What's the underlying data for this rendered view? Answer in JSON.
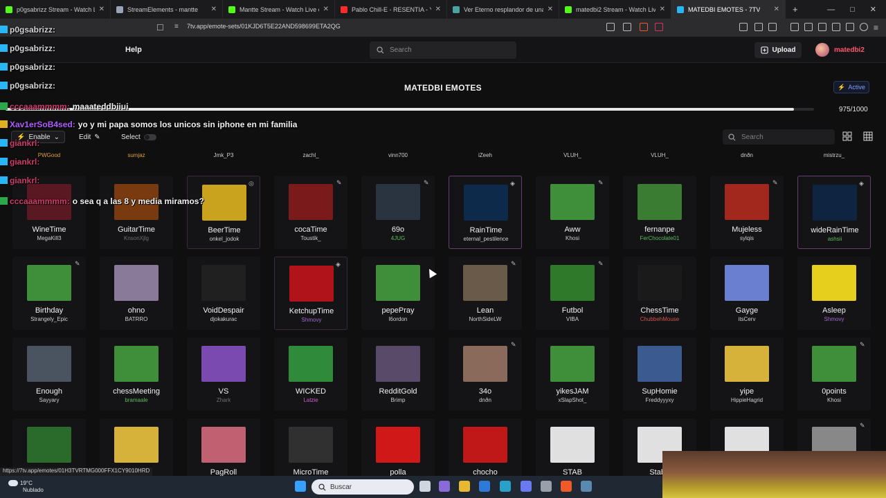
{
  "browser": {
    "tabs": [
      {
        "label": "p0gsabrizz Stream - Watch Live on Kick",
        "icon": "kick-icon",
        "color": "#53fc18"
      },
      {
        "label": "StreamElements - mantte",
        "icon": "streamelements-icon",
        "color": "#9aa4b5"
      },
      {
        "label": "Mantte Stream - Watch Live on Kick",
        "icon": "kick-icon",
        "color": "#53fc18"
      },
      {
        "label": "Pablo Chill-E - RESENTIA - YouTube",
        "icon": "youtube-icon",
        "color": "#ff2b2b"
      },
      {
        "label": "Ver Eterno resplandor de una mente",
        "icon": "stream-icon",
        "color": "#4aa3a0"
      },
      {
        "label": "matedbi2 Stream - Watch Live on Kick",
        "icon": "kick-icon",
        "color": "#53fc18"
      },
      {
        "label": "MATEDBI EMOTES - 7TV",
        "icon": "7tv-icon",
        "color": "#29b6f6",
        "active": true
      }
    ],
    "url": "7tv.app/emote-sets/01KJD6T5E22AND598699ETA2QG",
    "status_url": "https://7tv.app/emotes/01H3TVRTMG000FFX1CY9010HRD"
  },
  "site": {
    "nav_help": "Help",
    "search_placeholder": "Search",
    "upload_label": "Upload",
    "username": "matedbi2",
    "user_color": "#ff5570"
  },
  "emote_set": {
    "title": "MATEDBI EMOTES",
    "active_label": "Active",
    "capacity": {
      "used": 975,
      "total": 1000,
      "label": "975/1000"
    },
    "enable_label": "Enable",
    "edit_label": "Edit",
    "select_label": "Select",
    "search_placeholder": "Search"
  },
  "prev_row_owners": [
    {
      "name": "PWGood",
      "color": "#e0a030"
    },
    {
      "name": "sumjaz",
      "color": "#e0a030"
    },
    {
      "name": "Jmk_P3",
      "color": "#cfcfcf"
    },
    {
      "name": "zachl_",
      "color": "#cfcfcf"
    },
    {
      "name": "vinn700",
      "color": "#cfcfcf"
    },
    {
      "name": "iZeeh",
      "color": "#cfcfcf"
    },
    {
      "name": "VLUH_",
      "color": "#cfcfcf"
    },
    {
      "name": "VLUH_",
      "color": "#cfcfcf"
    },
    {
      "name": "dnðn",
      "color": "#cfcfcf"
    },
    {
      "name": "mistrzu_",
      "color": "#cfcfcf"
    }
  ],
  "emotes": [
    {
      "name": "WineTime",
      "owner": "MegaKill3",
      "owner_color": "#cfcfcf",
      "thumb": "#5a1822",
      "outline": false,
      "badge": ""
    },
    {
      "name": "GuitarTime",
      "owner": "KnsonXjlg",
      "owner_color": "#6e6e72",
      "thumb": "#7a3a10",
      "outline": false,
      "badge": ""
    },
    {
      "name": "BeerTime",
      "owner": "onkel_jodok",
      "owner_color": "#cfcfcf",
      "thumb": "#c9a21e",
      "outline": "outline",
      "badge": "◎"
    },
    {
      "name": "cocaTime",
      "owner": "Toustik_",
      "owner_color": "#cfcfcf",
      "thumb": "#7a1a1a",
      "outline": false,
      "badge": "✎"
    },
    {
      "name": "69o",
      "owner": "4JUG",
      "owner_color": "#5dbb5d",
      "thumb": "#2a3440",
      "outline": false,
      "badge": "✎"
    },
    {
      "name": "RainTime",
      "owner": "eternal_pestilence",
      "owner_color": "#cfcfcf",
      "thumb": "#0d2a4a",
      "outline": "outline2",
      "badge": "◈"
    },
    {
      "name": "Aww",
      "owner": "Khosi",
      "owner_color": "#cfcfcf",
      "thumb": "#3f8f3a",
      "outline": false,
      "badge": "✎"
    },
    {
      "name": "fernanpe",
      "owner": "FerChocolate01",
      "owner_color": "#5dbb5d",
      "thumb": "#3a7d32",
      "outline": false,
      "badge": ""
    },
    {
      "name": "Mujeless",
      "owner": "sylqis",
      "owner_color": "#cfcfcf",
      "thumb": "#a2281e",
      "outline": false,
      "badge": "✎"
    },
    {
      "name": "wideRainTime",
      "owner": "ashsii",
      "owner_color": "#5dbb5d",
      "thumb": "#0f2440",
      "outline": "outline2",
      "badge": "◈"
    },
    {
      "name": "Birthday",
      "owner": "Strangely_Epic",
      "owner_color": "#cfcfcf",
      "thumb": "#3f8f3a",
      "outline": false,
      "badge": "✎"
    },
    {
      "name": "ohno",
      "owner": "BATRRO",
      "owner_color": "#cfcfcf",
      "thumb": "#8a7a9a",
      "outline": false,
      "badge": ""
    },
    {
      "name": "VoidDespair",
      "owner": "djokakurac",
      "owner_color": "#cfcfcf",
      "thumb": "#202020",
      "outline": false,
      "badge": ""
    },
    {
      "name": "KetchupTime",
      "owner": "Shmovy",
      "owner_color": "#a06ad6",
      "thumb": "#b0141a",
      "outline": "outline",
      "badge": "◈"
    },
    {
      "name": "pepePray",
      "owner": "l6ordon",
      "owner_color": "#cfcfcf",
      "thumb": "#3f8f3a",
      "outline": false,
      "badge": ""
    },
    {
      "name": "Lean",
      "owner": "NorthSideLW",
      "owner_color": "#cfcfcf",
      "thumb": "#6a5a4a",
      "outline": false,
      "badge": "✎"
    },
    {
      "name": "Futbol",
      "owner": "VIBA",
      "owner_color": "#cfcfcf",
      "thumb": "#2f7a2a",
      "outline": false,
      "badge": "✎"
    },
    {
      "name": "ChessTime",
      "owner": "ChubbehMouse",
      "owner_color": "#d2554a",
      "thumb": "#1a1a1a",
      "outline": false,
      "badge": ""
    },
    {
      "name": "Gayge",
      "owner": "itsCerv",
      "owner_color": "#cfcfcf",
      "thumb": "#6a7fd0",
      "outline": false,
      "badge": ""
    },
    {
      "name": "Asleep",
      "owner": "Shmovy",
      "owner_color": "#a06ad6",
      "thumb": "#e7cf1e",
      "outline": false,
      "badge": ""
    },
    {
      "name": "Enough",
      "owner": "Sayyary",
      "owner_color": "#cfcfcf",
      "thumb": "#4a5460",
      "outline": false,
      "badge": ""
    },
    {
      "name": "chessMeeting",
      "owner": "bramaale",
      "owner_color": "#5dbb5d",
      "thumb": "#3f8f3a",
      "outline": false,
      "badge": ""
    },
    {
      "name": "VS",
      "owner": "Zhark",
      "owner_color": "#6e6e72",
      "thumb": "#7a4ab0",
      "outline": false,
      "badge": ""
    },
    {
      "name": "WICKED",
      "owner": "Latzie",
      "owner_color": "#d05bd0",
      "thumb": "#2f8a3a",
      "outline": false,
      "badge": ""
    },
    {
      "name": "RedditGold",
      "owner": "Brimp",
      "owner_color": "#cfcfcf",
      "thumb": "#5a4a6a",
      "outline": false,
      "badge": ""
    },
    {
      "name": "34o",
      "owner": "dnðn",
      "owner_color": "#cfcfcf",
      "thumb": "#8a6a5a",
      "outline": false,
      "badge": "✎"
    },
    {
      "name": "yikesJAM",
      "owner": "xSlapShot_",
      "owner_color": "#cfcfcf",
      "thumb": "#3f8f3a",
      "outline": false,
      "badge": ""
    },
    {
      "name": "SupHomie",
      "owner": "Freddyyyxy",
      "owner_color": "#cfcfcf",
      "thumb": "#3a5a90",
      "outline": false,
      "badge": ""
    },
    {
      "name": "yipe",
      "owner": "HippieHagrid",
      "owner_color": "#cfcfcf",
      "thumb": "#d6b23a",
      "outline": false,
      "badge": ""
    },
    {
      "name": "0points",
      "owner": "Khosi",
      "owner_color": "#cfcfcf",
      "thumb": "#3f8f3a",
      "outline": false,
      "badge": "✎"
    },
    {
      "name": "",
      "owner": "",
      "owner_color": "#cfcfcf",
      "thumb": "#2a6a2a",
      "outline": false,
      "badge": ""
    },
    {
      "name": "me",
      "owner": "",
      "owner_color": "#cfcfcf",
      "thumb": "#d6b23a",
      "outline": false,
      "badge": ""
    },
    {
      "name": "PagRoll",
      "owner": "",
      "owner_color": "#cfcfcf",
      "thumb": "#c06070",
      "outline": false,
      "badge": ""
    },
    {
      "name": "MicroTime",
      "owner": "",
      "owner_color": "#cfcfcf",
      "thumb": "#303030",
      "outline": false,
      "badge": ""
    },
    {
      "name": "polla",
      "owner": "",
      "owner_color": "#cfcfcf",
      "thumb": "#d01818",
      "outline": false,
      "badge": ""
    },
    {
      "name": "chocho",
      "owner": "",
      "owner_color": "#cfcfcf",
      "thumb": "#c01818",
      "outline": false,
      "badge": ""
    },
    {
      "name": "STAB",
      "owner": "",
      "owner_color": "#cfcfcf",
      "thumb": "#e0e0e0",
      "outline": false,
      "badge": ""
    },
    {
      "name": "StabT",
      "owner": "",
      "owner_color": "#cfcfcf",
      "thumb": "#e0e0e0",
      "outline": false,
      "badge": ""
    },
    {
      "name": "",
      "owner": "",
      "owner_color": "#cfcfcf",
      "thumb": "#e0e0e0",
      "outline": false,
      "badge": ""
    },
    {
      "name": "",
      "owner": "",
      "owner_color": "#cfcfcf",
      "thumb": "#888888",
      "outline": false,
      "badge": "✎"
    }
  ],
  "chat_overlay": [
    {
      "user": "p0gsabrizz:",
      "color": "#d6d6d6",
      "message": "",
      "badge_color": "#29b6f6"
    },
    {
      "user": "p0gsabrizz:",
      "color": "#d6d6d6",
      "message": "",
      "badge_color": "#29b6f6"
    },
    {
      "user": "p0gsabrizz:",
      "color": "#d6d6d6",
      "message": "",
      "badge_color": "#29b6f6"
    },
    {
      "user": "p0gsabrizz:",
      "color": "#d6d6d6",
      "message": "",
      "badge_color": "#29b6f6"
    },
    {
      "user": "cccaaammmm:",
      "color": "#d03a6a",
      "message": "maaateddbiiui",
      "badge_color": "#2ba84a"
    },
    {
      "user": "Xav1erSoB4sed:",
      "color": "#b05cff",
      "message": "yo y mi papa somos los unicos sin iphone en mi familia",
      "badge_color": "#e0b020"
    },
    {
      "user": "giankrl:",
      "color": "#d03a6a",
      "message": "",
      "badge_color": "#29b6f6"
    },
    {
      "user": "giankrl:",
      "color": "#d03a6a",
      "message": "",
      "badge_color": "#29b6f6"
    },
    {
      "user": "giankrl:",
      "color": "#d03a6a",
      "message": "",
      "badge_color": "#29b6f6"
    },
    {
      "user": "cccaaammmm:",
      "color": "#d03a6a",
      "message": "o sea q a las 8 y media miramos?",
      "badge_color": "#2ba84a"
    }
  ],
  "taskbar": {
    "weather_temp": "19°C",
    "weather_desc": "Nublado",
    "search_placeholder": "Buscar",
    "apps": [
      {
        "name": "windows-start-icon",
        "color": "#3aa0ff"
      },
      {
        "name": "task-view-icon",
        "color": "#cfd6e0"
      },
      {
        "name": "copilot-icon",
        "color": "#8a6ad6"
      },
      {
        "name": "file-explorer-icon",
        "color": "#e8b930"
      },
      {
        "name": "store-icon",
        "color": "#2f7ad6"
      },
      {
        "name": "edge-icon",
        "color": "#2aa1c8"
      },
      {
        "name": "discord-icon",
        "color": "#6a7af0"
      },
      {
        "name": "obs-icon",
        "color": "#9aa0aa"
      },
      {
        "name": "brave-icon",
        "color": "#f05a28"
      },
      {
        "name": "steam-icon",
        "color": "#5a8ab0"
      }
    ]
  }
}
